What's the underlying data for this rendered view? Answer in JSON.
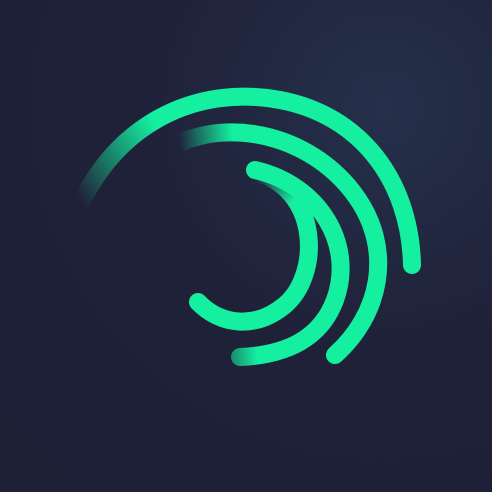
{
  "logo": {
    "icon": "swirl-arcs-logo-icon",
    "colors": {
      "background": "#1f2139",
      "accent": "#14f0a0"
    }
  }
}
